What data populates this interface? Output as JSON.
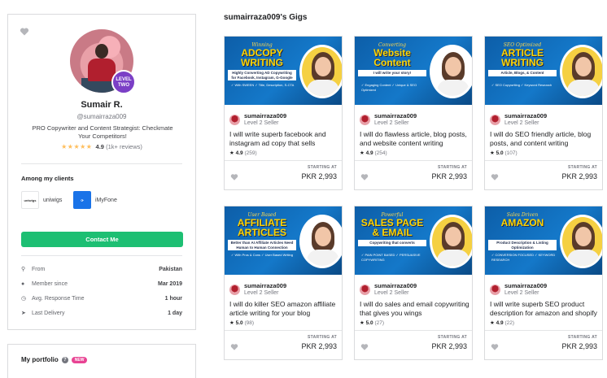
{
  "profile": {
    "name": "Sumair R.",
    "handle": "@sumairraza009",
    "level_badge": "LEVEL TWO",
    "description": "PRO Copywriter and Content Strategist: Checkmate Your Competitors!",
    "stars": "★★★★★",
    "rating": "4.9",
    "reviews": "(1k+ reviews)",
    "clients_title": "Among my clients",
    "clients": [
      {
        "logo": "uniwigs",
        "name": "uniwigs"
      },
      {
        "logo": "iMyFone",
        "name": "iMyFone"
      }
    ],
    "contact_label": "Contact Me",
    "stats": [
      {
        "icon": "location-pin-icon",
        "glyph": "⚲",
        "label": "From",
        "value": "Pakistan"
      },
      {
        "icon": "person-icon",
        "glyph": "●",
        "label": "Member since",
        "value": "Mar 2019"
      },
      {
        "icon": "clock-icon",
        "glyph": "◷",
        "label": "Avg. Response Time",
        "value": "1 hour"
      },
      {
        "icon": "send-icon",
        "glyph": "➤",
        "label": "Last Delivery",
        "value": "1 day"
      }
    ]
  },
  "portfolio": {
    "title": "My portfolio",
    "new_badge": "NEW"
  },
  "gigs_section": {
    "title": "sumairraza009's Gigs",
    "starting_at_label": "STARTING AT"
  },
  "gigs": [
    {
      "thumb_small": "Winning",
      "thumb_big": "ADCOPY WRITING",
      "thumb_strip": "Highly Converting AD Copywriting for Facebook, Instagram, G-Google",
      "thumb_bullets": "✓ With SWEEN  ✓ Title, Description, S-CTA",
      "seller": "sumairraza009",
      "level": "Level 2 Seller",
      "title": "I will write superb facebook and instagram ad copy that sells",
      "rating": "4.9",
      "reviews": "(259)",
      "price": "PKR 2,993",
      "accent": "#f5d042"
    },
    {
      "thumb_small": "Converting",
      "thumb_big": "Website Content",
      "thumb_strip": "I will write your story!",
      "thumb_bullets": "✓ Engaging Content  ✓ Unique & SEO Optimized",
      "seller": "sumairraza009",
      "level": "Level 2 Seller",
      "title": "I will do flawless article, blog posts, and website content writing",
      "rating": "4.9",
      "reviews": "(254)",
      "price": "PKR 2,993",
      "accent": "#ffffff"
    },
    {
      "thumb_small": "SEO Optimized",
      "thumb_big": "ARTICLE WRITING",
      "thumb_strip": "Article, Blogs, & Content",
      "thumb_bullets": "✓ SEO Copywriting  ✓ Keyword Research",
      "seller": "sumairraza009",
      "level": "Level 2 Seller",
      "title": "I will do SEO friendly article, blog posts, and content writing",
      "rating": "5.0",
      "reviews": "(107)",
      "price": "PKR 2,993",
      "accent": "#f5d042"
    },
    {
      "thumb_small": "User Based",
      "thumb_big": "AFFILIATE ARTICLES",
      "thumb_strip": "Better than AI Affiliate Articles Need Human to Human Connection",
      "thumb_bullets": "✓ With Pros & Cons  ✓ User Based Writing",
      "seller": "sumairraza009",
      "level": "Level 2 Seller",
      "title": "I will do killer SEO amazon affiliate article writing for your blog",
      "rating": "5.0",
      "reviews": "(98)",
      "price": "PKR 2,993",
      "accent": "#ffffff"
    },
    {
      "thumb_small": "Powerful",
      "thumb_big": "SALES PAGE & EMAIL",
      "thumb_strip": "Copywriting that converts",
      "thumb_bullets": "✓ PAIN POINT BASED  ✓ PERSUASIVE COPYWRITING",
      "seller": "sumairraza009",
      "level": "Level 2 Seller",
      "title": "I will do sales and email copywriting that gives you wings",
      "rating": "5.0",
      "reviews": "(27)",
      "price": "PKR 2,993",
      "accent": "#f5d042"
    },
    {
      "thumb_small": "Sales Driven",
      "thumb_big": "AMAZON",
      "thumb_strip": "Product Description & Listing Optimization",
      "thumb_bullets": "✓ CONVERSION FOCUSED  ✓ KEYWORD RESEARCH",
      "seller": "sumairraza009",
      "level": "Level 2 Seller",
      "title": "I will write superb SEO product description for amazon and shopify",
      "rating": "4.9",
      "reviews": "(22)",
      "price": "PKR 2,993",
      "accent": "#f5d042"
    }
  ]
}
